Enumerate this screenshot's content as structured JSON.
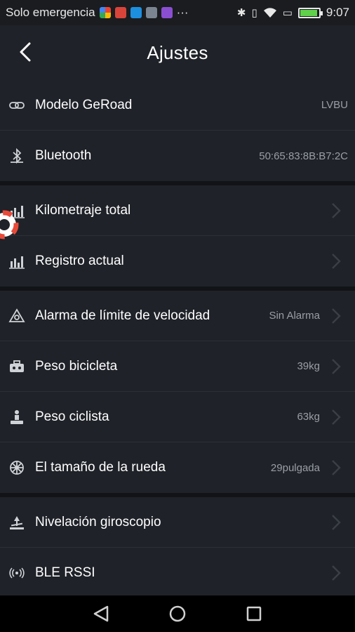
{
  "status_bar": {
    "carrier": "Solo emergencia",
    "more": "···",
    "time": "9:07"
  },
  "header": {
    "title": "Ajustes"
  },
  "sections": [
    {
      "rows": [
        {
          "label": "Modelo GeRoad",
          "value": "LVBU",
          "icon": "link-icon",
          "chevron": false
        },
        {
          "label": "Bluetooth",
          "value": "50:65:83:8B:B7:2C",
          "icon": "bluetooth-icon",
          "chevron": false
        }
      ]
    },
    {
      "rows": [
        {
          "label": "Kilometraje total",
          "value": "",
          "icon": "bar-chart-icon",
          "chevron": true
        },
        {
          "label": "Registro actual",
          "value": "",
          "icon": "bar-chart-icon",
          "chevron": true
        }
      ]
    },
    {
      "rows": [
        {
          "label": "Alarma de límite de velocidad",
          "value": "Sin Alarma",
          "icon": "speed-alarm-icon",
          "chevron": true
        },
        {
          "label": "Peso bicicleta",
          "value": "39kg",
          "icon": "bike-weight-icon",
          "chevron": true
        },
        {
          "label": "Peso ciclista",
          "value": "63kg",
          "icon": "rider-weight-icon",
          "chevron": true
        },
        {
          "label": "El tamaño de la rueda",
          "value": "29pulgada",
          "icon": "wheel-icon",
          "chevron": true
        }
      ]
    },
    {
      "rows": [
        {
          "label": "Nivelación giroscopio",
          "value": "",
          "icon": "gyroscope-icon",
          "chevron": true
        },
        {
          "label": "BLE RSSI",
          "value": "",
          "icon": "signal-icon",
          "chevron": true
        }
      ]
    }
  ],
  "colors": {
    "background": "#1f2228",
    "divider": "#111316",
    "value_text": "#9a9ea6",
    "chevron": "#3a3e45"
  }
}
